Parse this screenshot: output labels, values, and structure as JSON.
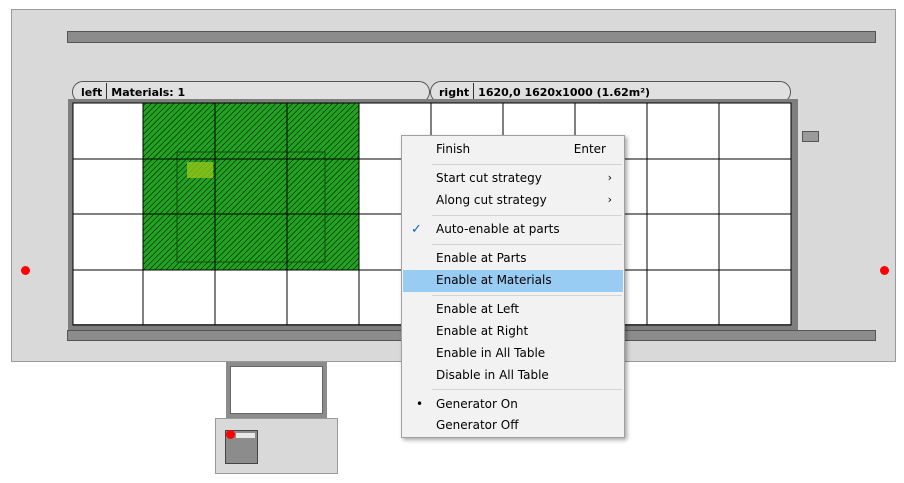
{
  "tabs": {
    "left": {
      "name": "left",
      "info": "Materials: 1"
    },
    "right": {
      "name": "right",
      "info": "1620,0 1620x1000 (1.62m²)"
    }
  },
  "colors": {
    "material": "#21a321",
    "highlight": "#99ccf3",
    "marker": "#ff0000"
  },
  "context_menu": {
    "finish": {
      "label": "Finish",
      "shortcut": "Enter"
    },
    "start_cut": {
      "label": "Start cut strategy"
    },
    "along_cut": {
      "label": "Along cut strategy"
    },
    "auto_enable": {
      "label": "Auto-enable at parts",
      "checked": true
    },
    "enable_parts": {
      "label": "Enable at Parts"
    },
    "enable_materials": {
      "label": "Enable at Materials",
      "highlighted": true
    },
    "enable_left": {
      "label": "Enable at Left"
    },
    "enable_right": {
      "label": "Enable at Right"
    },
    "enable_all": {
      "label": "Enable in All Table"
    },
    "disable_all": {
      "label": "Disable in All Table"
    },
    "generator_on": {
      "label": "Generator On",
      "selected": true
    },
    "generator_off": {
      "label": "Generator Off"
    }
  }
}
